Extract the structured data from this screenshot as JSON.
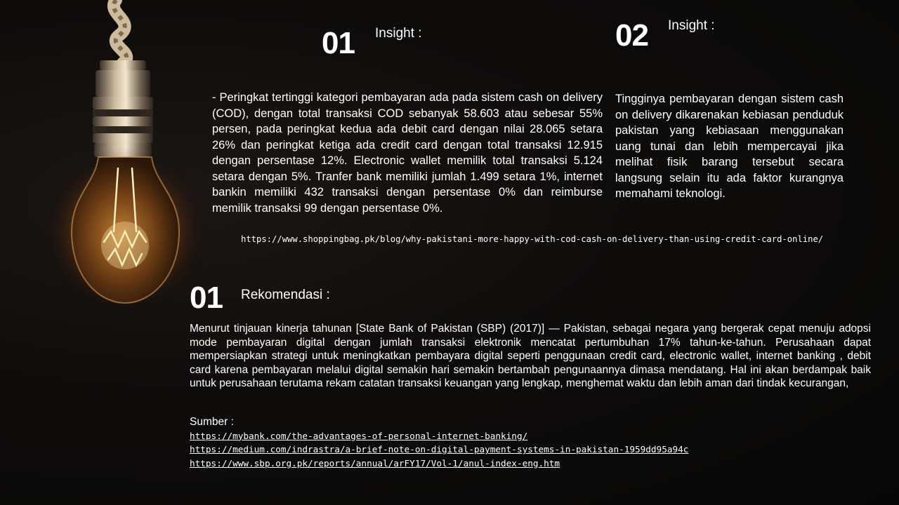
{
  "insight_1": {
    "number": "01",
    "label": "Insight  :",
    "text": "- Peringkat tertinggi kategori pembayaran ada pada sistem cash on delivery (COD), dengan total transaksi COD sebanyak 58.603 atau sebesar 55% persen, pada peringkat kedua ada debit card dengan nilai 28.065 setara 26% dan peringkat ketiga ada credit card dengan total transaksi 12.915 dengan persentase 12%. Electronic wallet memilik total transaksi 5.124 setara dengan 5%. Tranfer bank memiliki jumlah 1.499 setara 1%, internet bankin memiliki 432 transaksi dengan persentase 0% dan reimburse memilik transaksi 99 dengan persentase 0%."
  },
  "insight_2": {
    "number": "02",
    "label": "Insight  :",
    "text": "Tingginya pembayaran dengan sistem cash on delivery dikarenakan kebiasan penduduk pakistan yang kebiasaan menggunakan uang tunai dan lebih mempercayai jika melihat fisik barang tersebut secara langsung selain itu ada faktor kurangnya memahami teknologi."
  },
  "insight_source_url": "https://www.shoppingbag.pk/blog/why-pakistani-more-happy-with-cod-cash-on-delivery-than-using-credit-card-online/",
  "rekomendasi": {
    "number": "01",
    "label": "Rekomendasi  :",
    "text": "Menurut tinjauan kinerja tahunan [State Bank of Pakistan (SBP) (2017)] — Pakistan, sebagai negara yang bergerak cepat menuju adopsi mode pembayaran digital dengan jumlah transaksi elektronik mencatat pertumbuhan 17% tahun-ke-tahun. Perusahaan dapat mempersiapkan strategi untuk meningkatkan pembayara digital seperti penggunaan credit card, electronic wallet, internet banking , debit card karena pembayaran melalui digital semakin hari semakin bertambah pengunaannya dimasa mendatang. Hal ini akan berdampak baik untuk perusahaan terutama rekam catatan transaksi keuangan yang lengkap, menghemat waktu dan lebih aman dari tindak kecurangan,",
    "sources_label": "Sumber :",
    "sources": [
      "https://mybank.com/the-advantages-of-personal-internet-banking/",
      "https://medium.com/indrastra/a-brief-note-on-digital-payment-systems-in-pakistan-1959dd95a94c",
      "https://www.sbp.org.pk/reports/annual/arFY17/Vol-1/anul-index-eng.htm"
    ]
  },
  "colors": {
    "background": "#0b0a09",
    "text": "#ffffff",
    "bulb_glow": "#ffb347"
  }
}
